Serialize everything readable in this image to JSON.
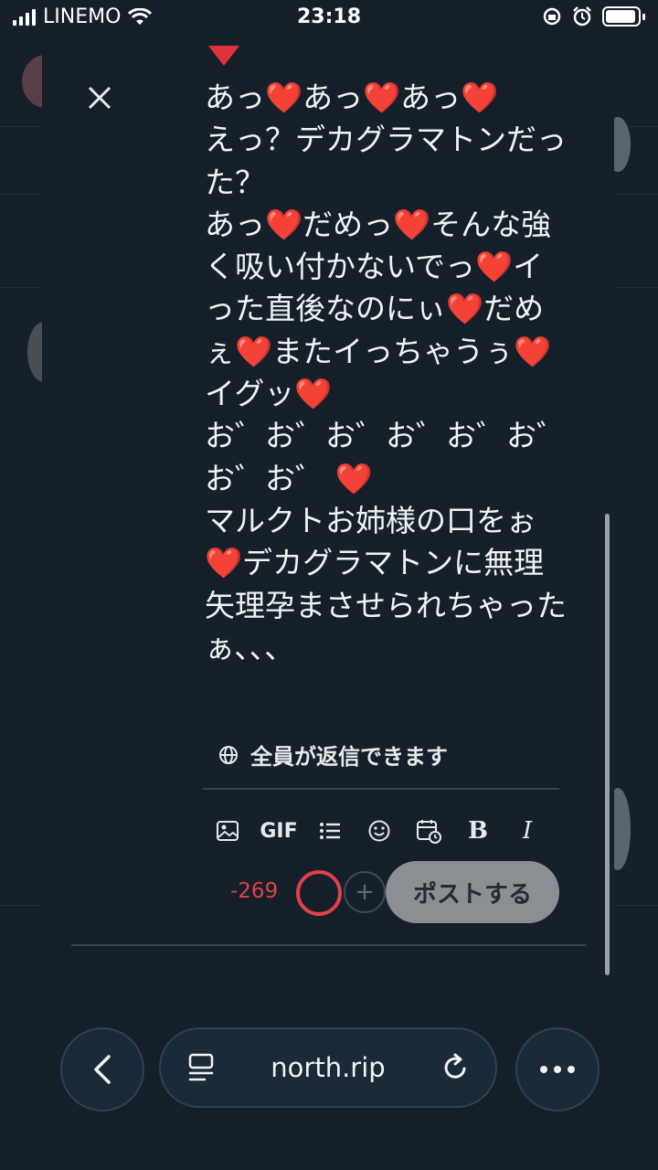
{
  "status_bar": {
    "carrier": "LINEMO",
    "time": "23:18"
  },
  "post": {
    "text": "あっ❤️あっ❤️あっ❤️\nえっ？デカグラマトンだった？\nあっ❤️だめっ❤️そんな強く吸い付かないでっ❤️イった直後なのにぃ❤️だめぇ❤️またイっちゃうぅ❤️イグッ❤️\nお゛お゛お゛お゛お゛お゛お゛お゛ ❤️\nマルクトお姉様の口をぉ❤️デカグラマトンに無理矢理孕まさせられちゃったぁ､､､"
  },
  "reply_setting": {
    "label": "全員が返信できます"
  },
  "toolbar": {
    "gif_label": "GIF",
    "bold_label": "B",
    "italic_label": "I"
  },
  "composer": {
    "char_count": "-269",
    "post_button_label": "ポストする"
  },
  "browser": {
    "url": "north.rip"
  },
  "colors": {
    "background": "#15202b",
    "over_limit": "#e0414a",
    "post_button": "#8b8f94"
  }
}
